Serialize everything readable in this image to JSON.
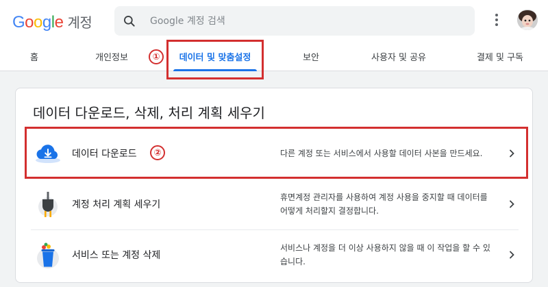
{
  "header": {
    "logo_letters": [
      "G",
      "o",
      "o",
      "g",
      "l",
      "e"
    ],
    "product_name": "계정",
    "search_placeholder": "Google 계정 검색",
    "menu_icon": "more-vert-icon",
    "avatar_icon": "profile-avatar"
  },
  "tabs": [
    {
      "label": "홈",
      "active": false
    },
    {
      "label": "개인정보",
      "active": false
    },
    {
      "label": "데이터 및 맞춤설정",
      "active": true
    },
    {
      "label": "보안",
      "active": false
    },
    {
      "label": "사용자 및 공유",
      "active": false
    },
    {
      "label": "결제 및 구독",
      "active": false
    }
  ],
  "annotations": {
    "marker_1": "①",
    "marker_2": "②",
    "color": "#d32f2f"
  },
  "card": {
    "title": "데이터 다운로드, 삭제, 처리 계획 세우기",
    "rows": [
      {
        "icon": "cloud-download-icon",
        "label": "데이터 다운로드",
        "desc": "다른 계정 또는 서비스에서 사용할 데이터 사본을 만드세요."
      },
      {
        "icon": "power-plug-icon",
        "label": "계정 처리 계획 세우기",
        "desc": "휴면계정 관리자를 사용하여 계정 사용을 중지할 때 데이터를 어떻게 처리할지 결정합니다."
      },
      {
        "icon": "trash-can-icon",
        "label": "서비스 또는 계정 삭제",
        "desc": "서비스나 계정을 더 이상 사용하지 않을 때 이 작업을 할 수 있습니다."
      }
    ]
  },
  "colors": {
    "accent": "#1a73e8",
    "highlight": "#d32f2f"
  }
}
